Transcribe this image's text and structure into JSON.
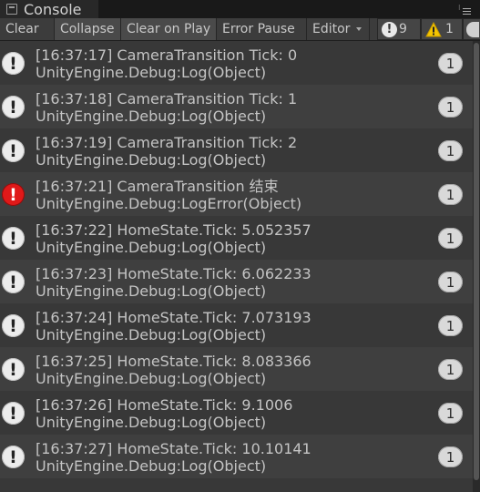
{
  "window": {
    "title": "Console"
  },
  "toolbar": {
    "clear": "Clear",
    "collapse": "Collapse",
    "clear_on_play": "Clear on Play",
    "error_pause": "Error Pause",
    "editor": "Editor",
    "info_count": "9",
    "warning_count": "1"
  },
  "colors": {
    "error": "#e01919",
    "warning": "#f4c400",
    "background": "#383838"
  },
  "log": [
    {
      "icon": "info-icon",
      "line1": "[16:37:17] CameraTransition Tick: 0",
      "line2": "UnityEngine.Debug:Log(Object)",
      "count": "1"
    },
    {
      "icon": "info-icon",
      "line1": "[16:37:18] CameraTransition Tick: 1",
      "line2": "UnityEngine.Debug:Log(Object)",
      "count": "1"
    },
    {
      "icon": "info-icon",
      "line1": "[16:37:19] CameraTransition Tick: 2",
      "line2": "UnityEngine.Debug:Log(Object)",
      "count": "1"
    },
    {
      "icon": "error-icon",
      "line1": "[16:37:21] CameraTransition 结束",
      "line2": "UnityEngine.Debug:LogError(Object)",
      "count": "1"
    },
    {
      "icon": "info-icon",
      "line1": "[16:37:22] HomeState.Tick: 5.052357",
      "line2": "UnityEngine.Debug:Log(Object)",
      "count": "1"
    },
    {
      "icon": "info-icon",
      "line1": "[16:37:23] HomeState.Tick: 6.062233",
      "line2": "UnityEngine.Debug:Log(Object)",
      "count": "1"
    },
    {
      "icon": "info-icon",
      "line1": "[16:37:24] HomeState.Tick: 7.073193",
      "line2": "UnityEngine.Debug:Log(Object)",
      "count": "1"
    },
    {
      "icon": "info-icon",
      "line1": "[16:37:25] HomeState.Tick: 8.083366",
      "line2": "UnityEngine.Debug:Log(Object)",
      "count": "1"
    },
    {
      "icon": "info-icon",
      "line1": "[16:37:26] HomeState.Tick: 9.1006",
      "line2": "UnityEngine.Debug:Log(Object)",
      "count": "1"
    },
    {
      "icon": "info-icon",
      "line1": "[16:37:27] HomeState.Tick: 10.10141",
      "line2": "UnityEngine.Debug:Log(Object)",
      "count": "1"
    }
  ]
}
